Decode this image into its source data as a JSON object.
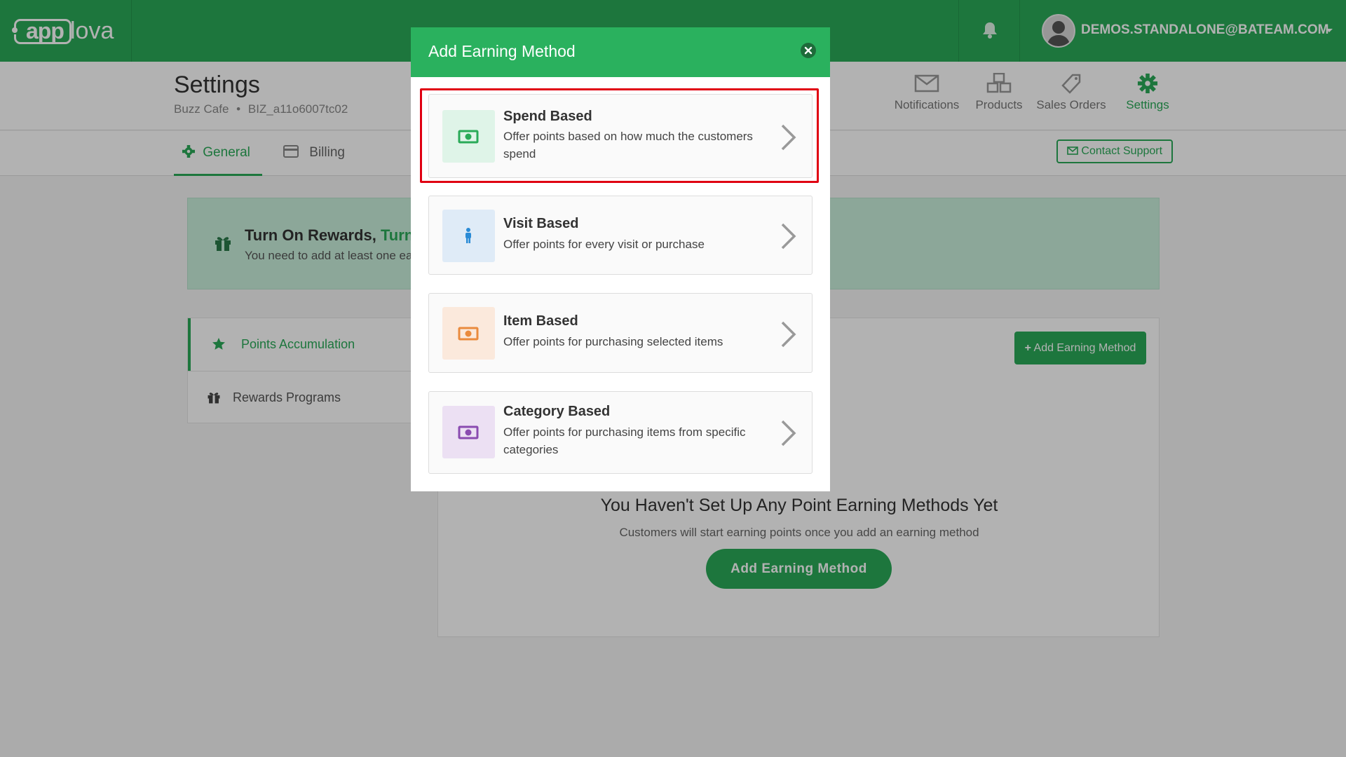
{
  "brand": {
    "logo_left": "app",
    "logo_right": "lova"
  },
  "user": {
    "email": "DEMOS.STANDALONE@BATEAM.COM"
  },
  "page": {
    "title": "Settings",
    "business_name": "Buzz Cafe",
    "business_id": "BIZ_a11o6007tc02"
  },
  "top_nav": [
    {
      "label": "Notifications",
      "icon": "envelope-icon"
    },
    {
      "label": "Products",
      "icon": "boxes-icon"
    },
    {
      "label": "Sales Orders",
      "icon": "tag-icon"
    },
    {
      "label": "Settings",
      "icon": "gear-icon"
    }
  ],
  "tabs": [
    {
      "label": "General",
      "icon": "gear-icon"
    },
    {
      "label": "Billing",
      "icon": "credit-card-icon"
    }
  ],
  "contact_support": "Contact Support",
  "banner": {
    "title": "Turn On Rewards,",
    "title_accent": "Turn",
    "text": "You need to add at least one ea"
  },
  "side_menu": [
    {
      "label": "Points Accumulation",
      "icon": "star-icon"
    },
    {
      "label": "Rewards Programs",
      "icon": "gift-icon"
    }
  ],
  "content": {
    "add_button_small": "Add Earning Method",
    "empty_title": "You Haven't Set Up Any Point Earning Methods Yet",
    "empty_subtitle": "Customers will start earning points once you add an earning method",
    "add_button_big": "Add Earning Method"
  },
  "modal": {
    "title": "Add Earning Method",
    "options": [
      {
        "title": "Spend Based",
        "description": "Offer points based on how much the customers spend",
        "icon": "money-icon",
        "icon_color": "#2aaa58",
        "icon_bg": "#dff4e8"
      },
      {
        "title": "Visit Based",
        "description": "Offer points for every visit or purchase",
        "icon": "person-icon",
        "icon_color": "#2a8bd6",
        "icon_bg": "#dfebf7"
      },
      {
        "title": "Item Based",
        "description": "Offer points for purchasing selected items",
        "icon": "money-icon",
        "icon_color": "#ea8b3e",
        "icon_bg": "#fbe9dc"
      },
      {
        "title": "Category Based",
        "description": "Offer points for purchasing items from specific categories",
        "icon": "money-icon",
        "icon_color": "#8a4bb0",
        "icon_bg": "#ece0f3"
      }
    ]
  },
  "colors": {
    "brand_green": "#2aaa58",
    "highlight_red": "#e00012"
  }
}
